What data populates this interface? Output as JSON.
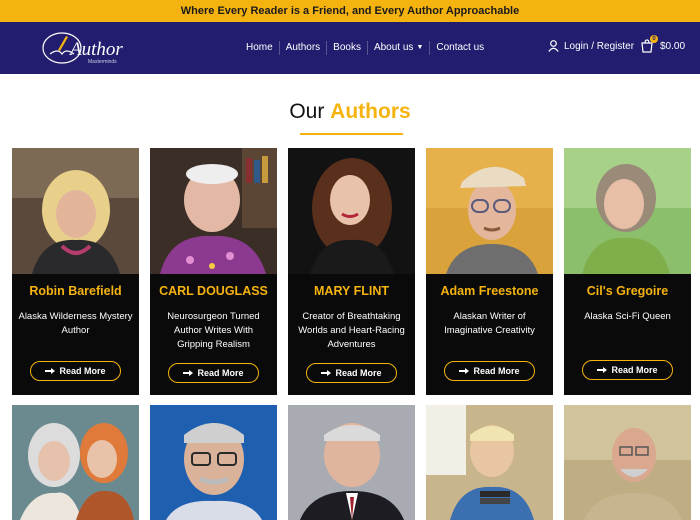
{
  "topbar": {
    "tagline": "Where Every Reader is a Friend, and Every Author Approachable"
  },
  "nav": {
    "logo_text": "Author",
    "logo_subtext": "Masterminds",
    "links": [
      "Home",
      "Authors",
      "Books",
      "About us",
      "Contact us"
    ],
    "login_label": "Login / Register",
    "cart_total": "$0.00",
    "cart_count": "0"
  },
  "section": {
    "title_first": "Our",
    "title_accent": "Authors"
  },
  "authors": [
    {
      "name": "Robin Barefield",
      "desc": "Alaska Wilderness Mystery Author",
      "button": "Read More"
    },
    {
      "name": "CARL DOUGLASS",
      "desc": "Neurosurgeon Turned Author Writes With Gripping Realism",
      "button": "Read More"
    },
    {
      "name": "MARY FLINT",
      "desc": "Creator of Breathtaking Worlds and Heart-Racing Adventures",
      "button": "Read More"
    },
    {
      "name": "Adam Freestone",
      "desc": "Alaskan Writer of Imaginative Creativity",
      "button": "Read More"
    },
    {
      "name": "Cil's Gregoire",
      "desc": "Alaska Sci-Fi Queen",
      "button": "Read More"
    }
  ],
  "colors": {
    "accent": "#f5b30f",
    "nav_bg": "#221d6e",
    "card_bg": "#0a0a0a"
  }
}
